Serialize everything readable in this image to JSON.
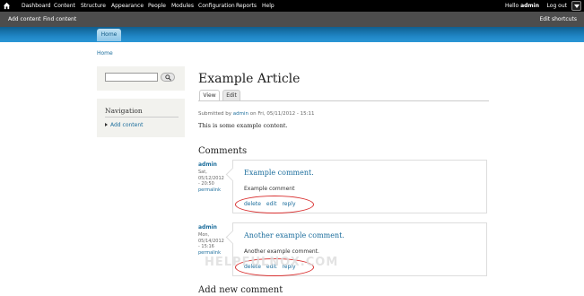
{
  "toolbar": {
    "items": [
      "Dashboard",
      "Content",
      "Structure",
      "Appearance",
      "People",
      "Modules",
      "Configuration",
      "Reports",
      "Help"
    ],
    "hello_prefix": "Hello ",
    "user": "admin",
    "logout": "Log out"
  },
  "shortcuts": {
    "items": [
      "Add content",
      "Find content"
    ],
    "edit": "Edit shortcuts"
  },
  "header": {
    "home_tab": "Home"
  },
  "breadcrumb": "Home",
  "sidebar": {
    "navigation_title": "Navigation",
    "nav_items": [
      "Add content"
    ]
  },
  "node": {
    "title": "Example Article",
    "tabs": [
      "View",
      "Edit"
    ],
    "submitted_prefix": "Submitted by ",
    "submitted_author": "admin",
    "submitted_suffix": " on Fri, 05/11/2012 - 15:11",
    "body": "This is some example content."
  },
  "comments": {
    "heading": "Comments",
    "items": [
      {
        "author": "admin",
        "date": "Sat, 05/12/2012 - 20:50",
        "permalink": "permalink",
        "title": "Example comment.",
        "body": "Example comment",
        "links": [
          "delete",
          "edit",
          "reply"
        ]
      },
      {
        "author": "admin",
        "date": "Mon, 05/14/2012 - 15:16",
        "permalink": "permalink",
        "title": "Another example comment.",
        "body": "Another example comment.",
        "links": [
          "delete",
          "edit",
          "reply"
        ]
      }
    ],
    "add_new": "Add new comment"
  },
  "watermark": "HELPFULNOX.COM",
  "colors": {
    "toolbar_bg": "#000000",
    "shortcuts_bg": "#4d4d4d",
    "header_blue": "#1f85c4",
    "link": "#1b6d9c",
    "highlight_oval": "#d93030"
  }
}
